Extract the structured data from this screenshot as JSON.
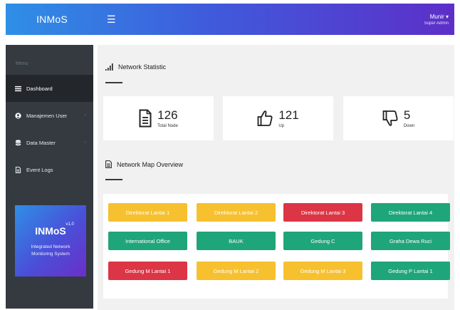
{
  "app": {
    "brand": "INMoS"
  },
  "header": {
    "user_name": "Munir ▾",
    "user_role": "Super Admin"
  },
  "sidebar": {
    "heading": "Menu",
    "items": [
      {
        "label": "Dashboard",
        "icon": "list-icon",
        "active": true
      },
      {
        "label": "Manajemen User",
        "icon": "user-icon"
      },
      {
        "label": "Data Master",
        "icon": "database-icon"
      },
      {
        "label": "Event Logs",
        "icon": "file-icon"
      }
    ],
    "promo": {
      "title": "INMoS",
      "version": "v1.0",
      "line1": "Integrated Network",
      "line2": "Monitoring System"
    }
  },
  "statistic": {
    "title": "Network Statistic",
    "cards": [
      {
        "value": "126",
        "label": "Total Node",
        "icon": "document-icon"
      },
      {
        "value": "121",
        "label": "Up",
        "icon": "thumbs-up-icon"
      },
      {
        "value": "5",
        "label": "Down",
        "icon": "thumbs-down-icon"
      }
    ]
  },
  "map": {
    "title": "Network Map Overview",
    "colors": {
      "yellow": "#f6c02f",
      "red": "#dc3545",
      "green": "#1fa57a"
    },
    "buttons": [
      {
        "label": "Direktorat Lantai 1",
        "color": "yellow"
      },
      {
        "label": "Direktorat Lantai 2",
        "color": "yellow"
      },
      {
        "label": "Direktorat Lantai 3",
        "color": "red"
      },
      {
        "label": "Direktorat Lantai 4",
        "color": "green"
      },
      {
        "label": "International Office",
        "color": "green"
      },
      {
        "label": "BAUK",
        "color": "green"
      },
      {
        "label": "Gedung C",
        "color": "green"
      },
      {
        "label": "Graha Dewa Ruci",
        "color": "green"
      },
      {
        "label": "Gedung M Lantai 1",
        "color": "red"
      },
      {
        "label": "Gedung M Lantai 2",
        "color": "yellow"
      },
      {
        "label": "Gedung M Lantai 3",
        "color": "yellow"
      },
      {
        "label": "Gedung P Lantai 1",
        "color": "green"
      }
    ]
  }
}
